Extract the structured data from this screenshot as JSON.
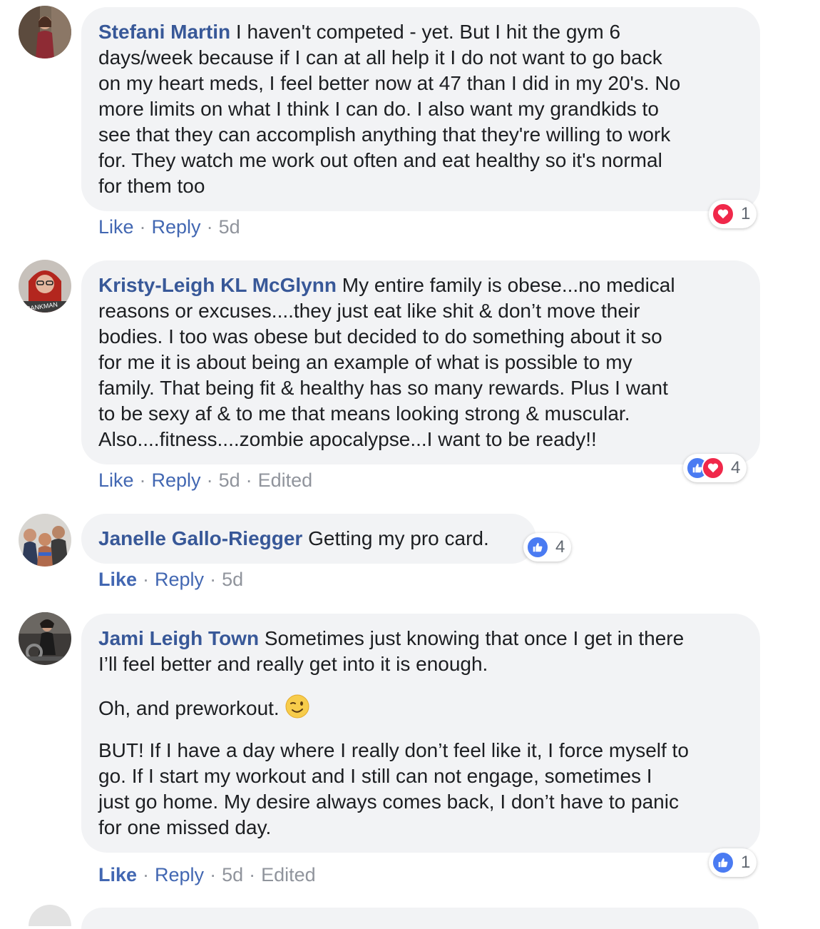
{
  "comments": [
    {
      "name": "Stefani Martin",
      "text_lines": [
        "I haven't competed - yet. But I hit the gym 6",
        "days/week because if I can at all help it I do not want to go back",
        "on my heart meds, I feel better now at 47 than I did in my 20's. No",
        "more limits on what I think I can do. I also want my grandkids to",
        "see that they can accomplish anything that they're willing to work",
        "for. They watch me work out often and eat healthy so it's normal",
        "for them too"
      ],
      "actions": {
        "like": "Like",
        "reply": "Reply",
        "time": "5d"
      },
      "reactions": {
        "icons": [
          "love"
        ],
        "count": "1"
      }
    },
    {
      "name": "Kristy-Leigh KL McGlynn",
      "text_lines": [
        "My entire family is obese...no medical",
        "reasons or excuses....they just eat like shit & don’t move their",
        "bodies. I too was obese but decided to do something about it so",
        "for me it is about being an example of what is possible to my",
        "family. That being fit & healthy has so many rewards. Plus I want",
        "to be sexy af & to me that means looking strong & muscular.",
        "Also....fitness....zombie apocalypse...I want to be ready!!"
      ],
      "avatar_caption": "PRANKMAN",
      "actions": {
        "like": "Like",
        "reply": "Reply",
        "time": "5d",
        "edited": "Edited"
      },
      "reactions": {
        "icons": [
          "like",
          "love"
        ],
        "count": "4"
      }
    },
    {
      "name": "Janelle Gallo-Riegger",
      "text_lines": [
        "Getting my pro card."
      ],
      "actions": {
        "like": "Like",
        "reply": "Reply",
        "time": "5d"
      },
      "reactions": {
        "icons": [
          "like"
        ],
        "count": "4"
      }
    },
    {
      "name": "Jami Leigh Town",
      "para1_lines": [
        "Sometimes just knowing that once I get in there",
        "I’ll feel better and really get into it is enough."
      ],
      "para2": "Oh, and preworkout.",
      "para3_lines": [
        "BUT! If I have a day where I really don’t feel like it, I force myself to",
        "go. If I start my workout and I still can not engage, sometimes I",
        "just go home. My desire always comes back, I don’t have to panic",
        "for one missed day."
      ],
      "actions": {
        "like": "Like",
        "reply": "Reply",
        "time": "5d",
        "edited": "Edited"
      },
      "reactions": {
        "icons": [
          "like"
        ],
        "count": "1"
      }
    }
  ],
  "colors": {
    "name": "#385898",
    "link": "#4267b2",
    "meta": "#90949c",
    "bubble": "#f2f3f5",
    "like": "#4a7bf2",
    "love": "#f0284a"
  }
}
